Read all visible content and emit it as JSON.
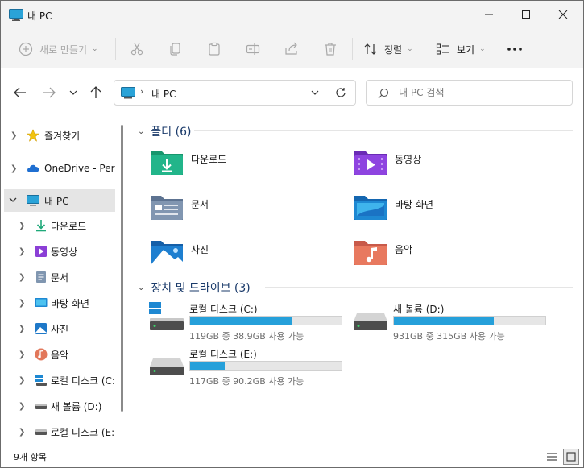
{
  "window": {
    "title": "내 PC"
  },
  "toolbar": {
    "new_label": "새로 만들기",
    "sort_label": "정렬",
    "view_label": "보기"
  },
  "address": {
    "path": "내 PC"
  },
  "search": {
    "placeholder": "내 PC 검색"
  },
  "sidebar": {
    "items": [
      {
        "label": "즐겨찾기"
      },
      {
        "label": "OneDrive - Personal"
      },
      {
        "label": "내 PC"
      },
      {
        "label": "다운로드"
      },
      {
        "label": "동영상"
      },
      {
        "label": "문서"
      },
      {
        "label": "바탕 화면"
      },
      {
        "label": "사진"
      },
      {
        "label": "음악"
      },
      {
        "label": "로컬 디스크 (C:)"
      },
      {
        "label": "새 볼륨 (D:)"
      },
      {
        "label": "로컬 디스크 (E:)"
      }
    ]
  },
  "folders_group": {
    "header": "폴더 (6)",
    "items": [
      {
        "label": "다운로드"
      },
      {
        "label": "동영상"
      },
      {
        "label": "문서"
      },
      {
        "label": "바탕 화면"
      },
      {
        "label": "사진"
      },
      {
        "label": "음악"
      }
    ]
  },
  "drives_group": {
    "header": "장치 및 드라이브 (3)",
    "items": [
      {
        "name": "로컬 디스크 (C:)",
        "info": "119GB 중 38.9GB 사용 가능",
        "used_fraction": 0.67
      },
      {
        "name": "새 볼륨 (D:)",
        "info": "931GB 중 315GB 사용 가능",
        "used_fraction": 0.66
      },
      {
        "name": "로컬 디스크 (E:)",
        "info": "117GB 중 90.2GB 사용 가능",
        "used_fraction": 0.23
      }
    ]
  },
  "status": {
    "count": "9개 항목"
  },
  "colors": {
    "accent": "#26a0da",
    "selected_bg": "#e5e5e5",
    "titlebar_bg": "#f3f3f3"
  }
}
